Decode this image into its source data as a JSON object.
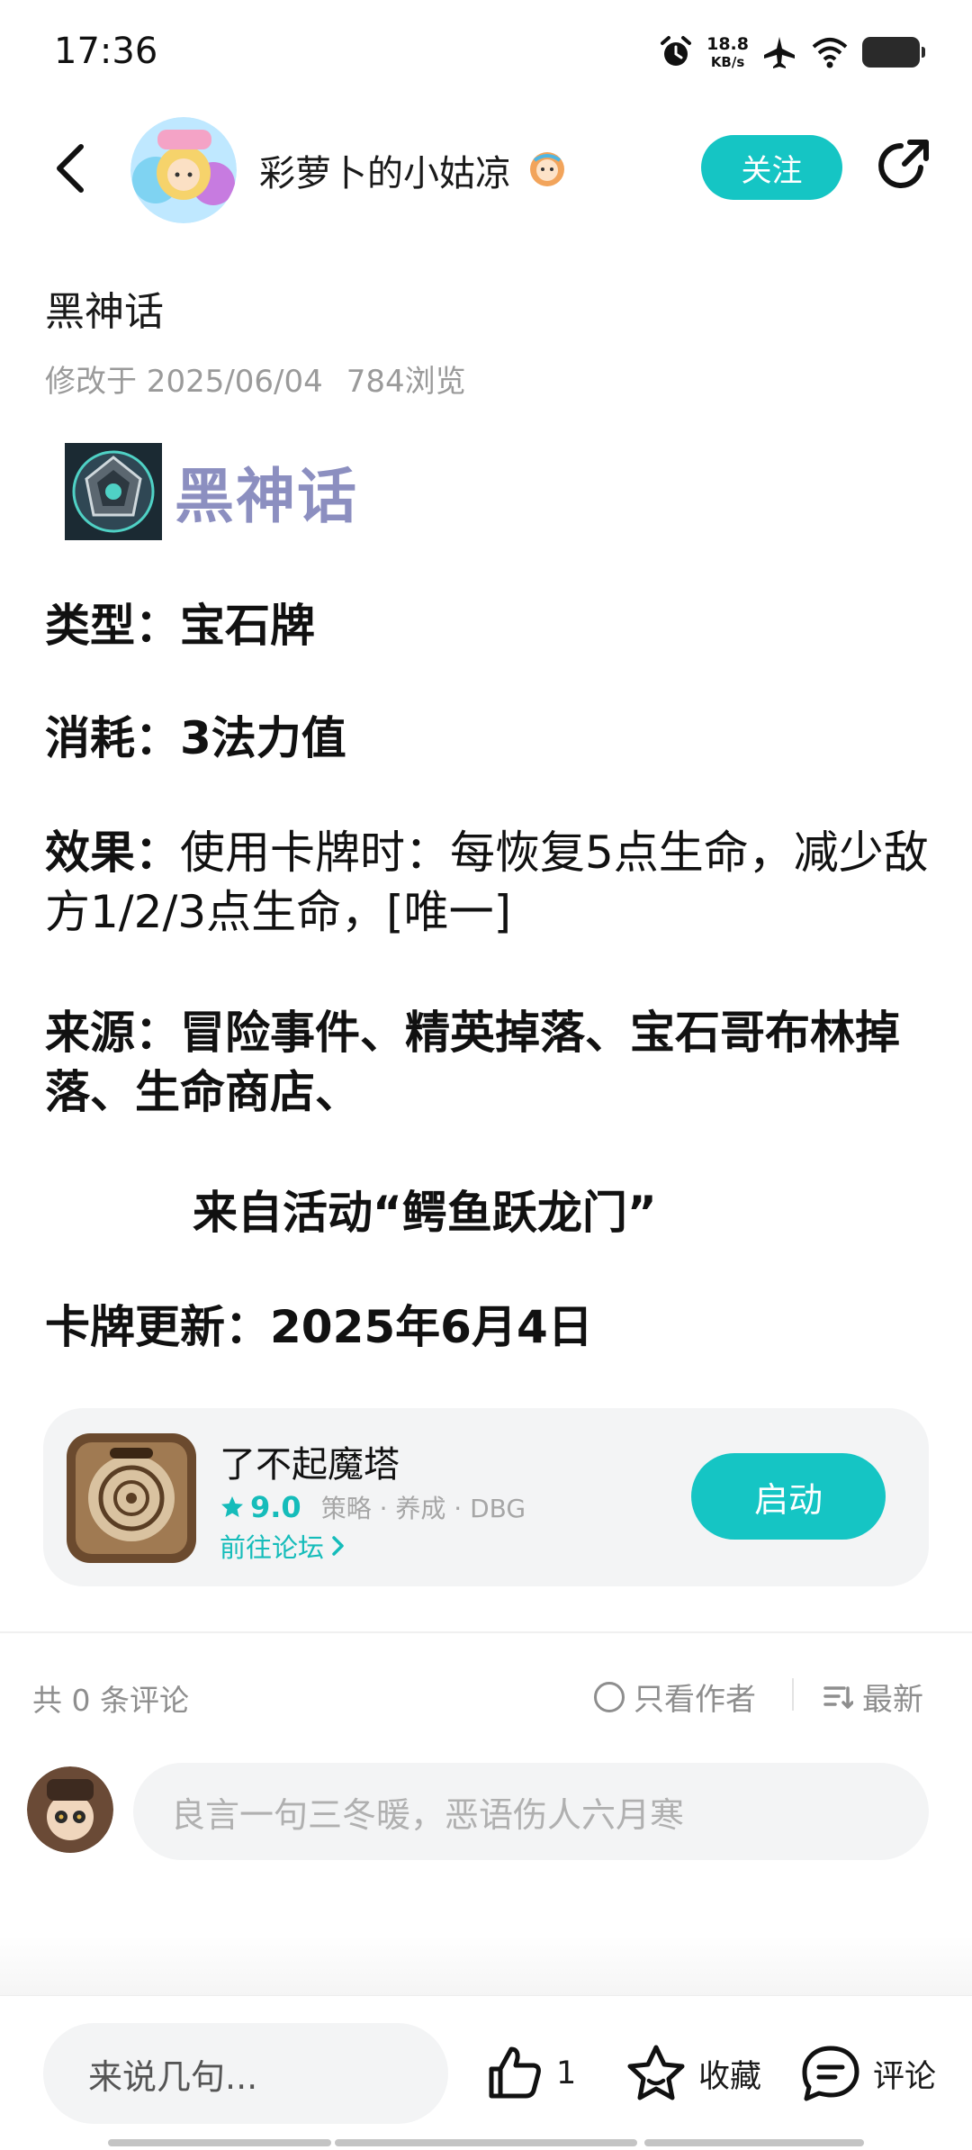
{
  "status_bar": {
    "time": "17:36",
    "net_speed_value": "18.8",
    "net_speed_unit": "KB/s",
    "icons": [
      "alarm-icon",
      "airplane-icon",
      "wifi-icon",
      "battery-icon"
    ]
  },
  "header": {
    "author_name": "彩萝卜的小姑凉",
    "follow_label": "关注"
  },
  "post": {
    "title": "黑神话",
    "modified": "修改于 2025/06/04",
    "views": "784浏览",
    "card_name": "黑神话",
    "fields": {
      "type_key": "类型：",
      "type_value": "宝石牌",
      "cost_key": "消耗：",
      "cost_value": "3法力值",
      "effect_key": "效果：",
      "effect_value": "使用卡牌时：每恢复5点生命，减少敌方1/2/3点生命，[唯一]",
      "source_key": "来源：",
      "source_value": "冒险事件、精英掉落、宝石哥布林掉落、生命商店、",
      "source_extra": "来自活动“鳄鱼跃龙门”",
      "update_key": "卡牌更新：",
      "update_value": "2025年6月4日"
    }
  },
  "app_card": {
    "name": "了不起魔塔",
    "rating": "9.0",
    "tags": "策略 · 养成 · DBG",
    "forum_link": "前往论坛",
    "launch_label": "启动"
  },
  "comments": {
    "count_text": "共 0 条评论",
    "only_author": "只看作者",
    "sort": "最新",
    "input_placeholder": "良言一句三冬暖，恶语伤人六月寒"
  },
  "bottom_bar": {
    "say_placeholder": "来说几句...",
    "like_count": "1",
    "favorite_label": "收藏",
    "comment_label": "评论"
  },
  "colors": {
    "accent": "#15c5c4",
    "card_name": "#8c8fc0",
    "muted": "#9a9a9a"
  }
}
